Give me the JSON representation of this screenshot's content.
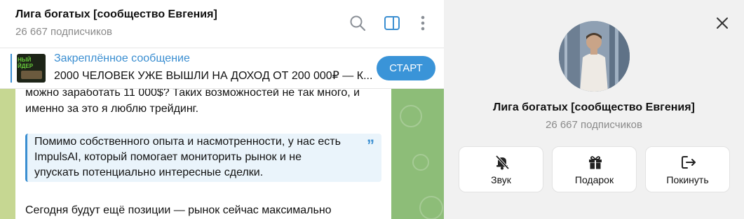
{
  "header": {
    "title": "Лига богатых [сообщество Евгения]",
    "subscribers": "26 667 подписчиков",
    "icons": [
      "search-icon",
      "sidebar-toggle-icon",
      "more-vertical-icon"
    ]
  },
  "pinned": {
    "title": "Закреплённое сообщение",
    "text": "2000 ЧЕЛОВЕК УЖЕ ВЫШЛИ НА ДОХОД ОТ 200 000₽ — К...",
    "thumb_text": "НЫЙ ЙДЕР",
    "button": "СТАРТ"
  },
  "message": {
    "line1": "можно заработать 11 000$? Таких возможностей не так много, и",
    "line2": "именно за это я люблю трейдинг.",
    "quote_lines": [
      "Помимо собственного опыта и насмотренности, у нас есть",
      "ImpulsAI, который помогает мониторить рынок и не",
      "упускать потенциально интересные сделки."
    ],
    "line3": "Сегодня будут ещё позиции — рынок сейчас максимально"
  },
  "panel": {
    "title": "Лига богатых [сообщество Евгения]",
    "subscribers": "26 667 подписчиков",
    "actions": [
      {
        "label": "Звук",
        "icon": "bell-off-icon"
      },
      {
        "label": "Подарок",
        "icon": "gift-icon"
      },
      {
        "label": "Покинуть",
        "icon": "leave-icon"
      }
    ]
  },
  "colors": {
    "accent": "#3a8ed1",
    "button": "#3a94d8",
    "chat_bg": "#9ec58a"
  }
}
